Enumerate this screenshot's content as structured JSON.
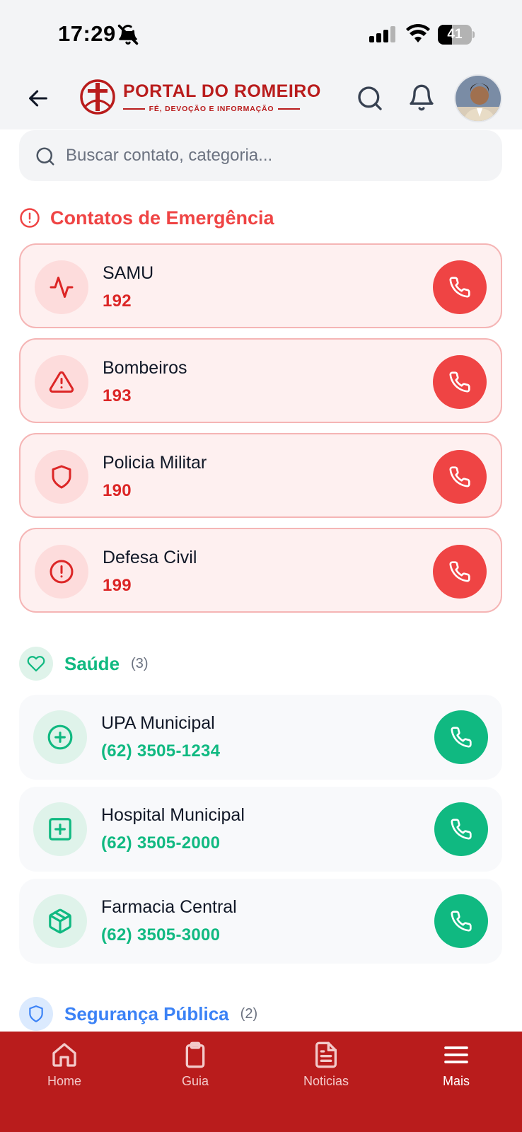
{
  "status_bar": {
    "time": "17:29",
    "battery": "41",
    "battery_level": 0.41
  },
  "header": {
    "logo_title": "PORTAL DO ROMEIRO",
    "logo_subtitle": "FÉ, DEVOÇÃO E INFORMAÇÃO"
  },
  "search": {
    "placeholder": "Buscar contato, categoria..."
  },
  "emergency": {
    "title": "Contatos de Emergência",
    "contacts": [
      {
        "name": "SAMU",
        "phone": "192",
        "icon": "activity-icon"
      },
      {
        "name": "Bombeiros",
        "phone": "193",
        "icon": "warning-triangle-icon"
      },
      {
        "name": "Policia Militar",
        "phone": "190",
        "icon": "shield-icon"
      },
      {
        "name": "Defesa Civil",
        "phone": "199",
        "icon": "alert-circle-icon"
      }
    ]
  },
  "categories": [
    {
      "title": "Saúde",
      "count": "(3)",
      "icon": "heart-icon",
      "color": "#10b981",
      "contacts": [
        {
          "name": "UPA Municipal",
          "phone": "(62) 3505-1234",
          "icon": "plus-circle-icon"
        },
        {
          "name": "Hospital Municipal",
          "phone": "(62) 3505-2000",
          "icon": "plus-square-icon"
        },
        {
          "name": "Farmacia Central",
          "phone": "(62) 3505-3000",
          "icon": "package-icon"
        }
      ]
    },
    {
      "title": "Segurança Pública",
      "count": "(2)",
      "icon": "shield-icon",
      "color": "#3b82f6"
    }
  ],
  "bottom_nav": {
    "items": [
      {
        "label": "Home",
        "icon": "home-icon"
      },
      {
        "label": "Guia",
        "icon": "clipboard-icon"
      },
      {
        "label": "Noticias",
        "icon": "document-icon"
      },
      {
        "label": "Mais",
        "icon": "menu-icon",
        "active": true
      }
    ]
  },
  "colors": {
    "brand": "#b91c1c",
    "emergency": "#ef4444",
    "health": "#10b981",
    "security": "#3b82f6"
  }
}
